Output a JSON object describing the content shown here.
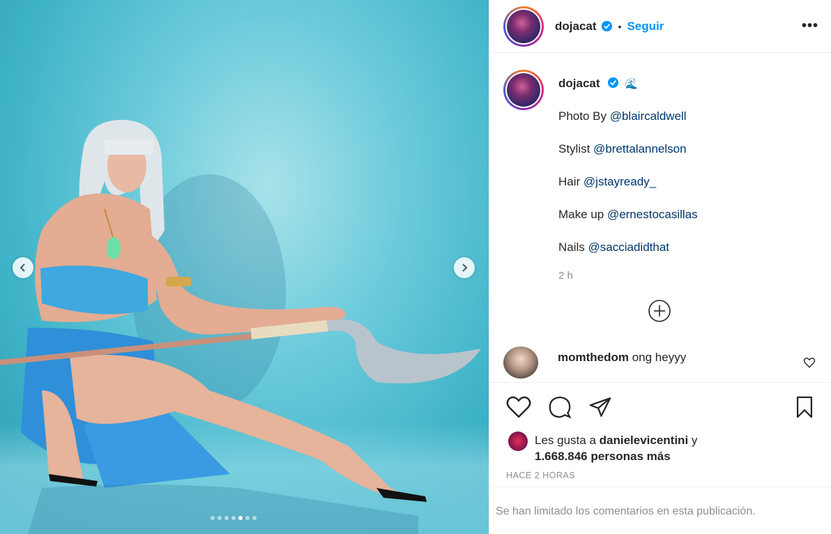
{
  "post": {
    "media": {
      "prev_icon": "chevron-left-icon",
      "next_icon": "chevron-right-icon",
      "slide_count": 7,
      "active_slide": 5
    },
    "header": {
      "username": "dojacat",
      "separator": "•",
      "follow_label": "Seguir",
      "more_label": "•••"
    },
    "caption": {
      "username": "dojacat",
      "emoji": "🌊",
      "lines": [
        {
          "prefix": "Photo By ",
          "mention": "@blaircaldwell"
        },
        {
          "prefix": "Stylist ",
          "mention": "@brettalannelson"
        },
        {
          "prefix": "Hair ",
          "mention": "@jstayready_"
        },
        {
          "prefix": "Make up ",
          "mention": "@ernestocasillas"
        },
        {
          "prefix": "Nails ",
          "mention": "@sacciadidthat"
        }
      ],
      "time": "2 h"
    },
    "comment": {
      "username": "momthedom",
      "text": " ong heyyy"
    },
    "likes": {
      "prefix": "Les gusta a ",
      "user": "danielevicentini",
      "mid": " y",
      "count": "1.668.846 personas más"
    },
    "time_ago": "HACE 2 HORAS",
    "comments_limited": "Se han limitado los comentarios en esta publicación."
  },
  "colors": {
    "accent": "#0095f6",
    "mention": "#00376b",
    "muted": "#8e8e8e",
    "text": "#262626"
  }
}
